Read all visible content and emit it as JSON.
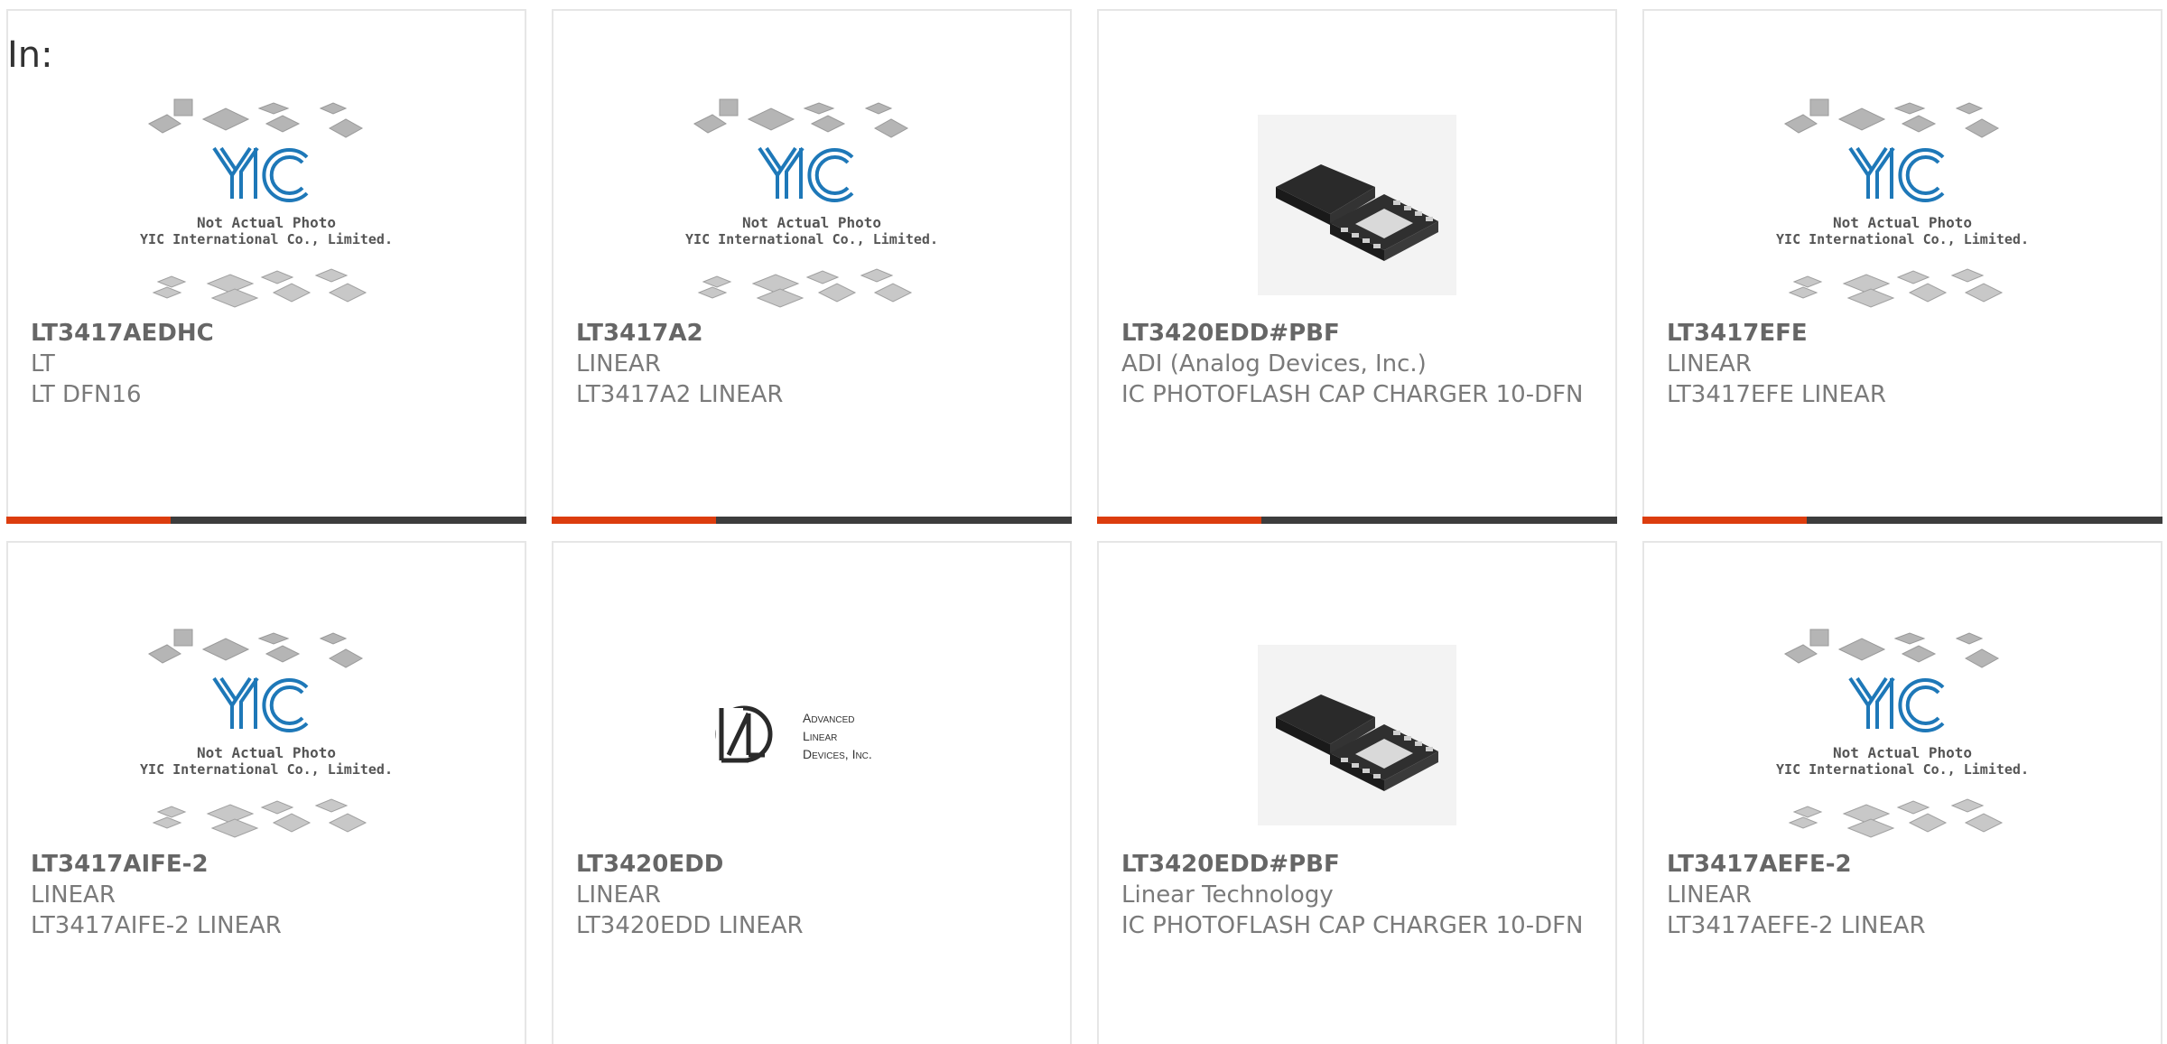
{
  "header": {
    "in_label": "In:"
  },
  "images": {
    "placeholder_line1": "Not Actual Photo",
    "placeholder_line2": "YIC International Co., Limited.",
    "placeholder_logo": "YIC",
    "ald_line1": "Advanced",
    "ald_line2": "Linear",
    "ald_line3": "Devices, Inc."
  },
  "colors": {
    "accent": "#dc3d0e",
    "bar": "#3d3d3d",
    "logo_blue": "#1e78b8"
  },
  "products": [
    {
      "part": "LT3417AEDHC",
      "maker": "LT",
      "desc": "LT DFN16",
      "image": "yic-placeholder"
    },
    {
      "part": "LT3417A2",
      "maker": "LINEAR",
      "desc": "LT3417A2 LINEAR",
      "image": "yic-placeholder"
    },
    {
      "part": "LT3420EDD#PBF",
      "maker": "ADI (Analog Devices, Inc.)",
      "desc": "IC PHOTOFLASH CAP CHARGER 10-DFN",
      "image": "dfn-chip"
    },
    {
      "part": "LT3417EFE",
      "maker": "LINEAR",
      "desc": "LT3417EFE LINEAR",
      "image": "yic-placeholder"
    },
    {
      "part": "LT3417AIFE-2",
      "maker": "LINEAR",
      "desc": "LT3417AIFE-2 LINEAR",
      "image": "yic-placeholder"
    },
    {
      "part": "LT3420EDD",
      "maker": "LINEAR",
      "desc": "LT3420EDD LINEAR",
      "image": "ald-logo"
    },
    {
      "part": "LT3420EDD#PBF",
      "maker": "Linear Technology",
      "desc": "IC PHOTOFLASH CAP CHARGER 10-DFN",
      "image": "dfn-chip"
    },
    {
      "part": "LT3417AEFE-2",
      "maker": "LINEAR",
      "desc": "LT3417AEFE-2 LINEAR",
      "image": "yic-placeholder"
    }
  ]
}
